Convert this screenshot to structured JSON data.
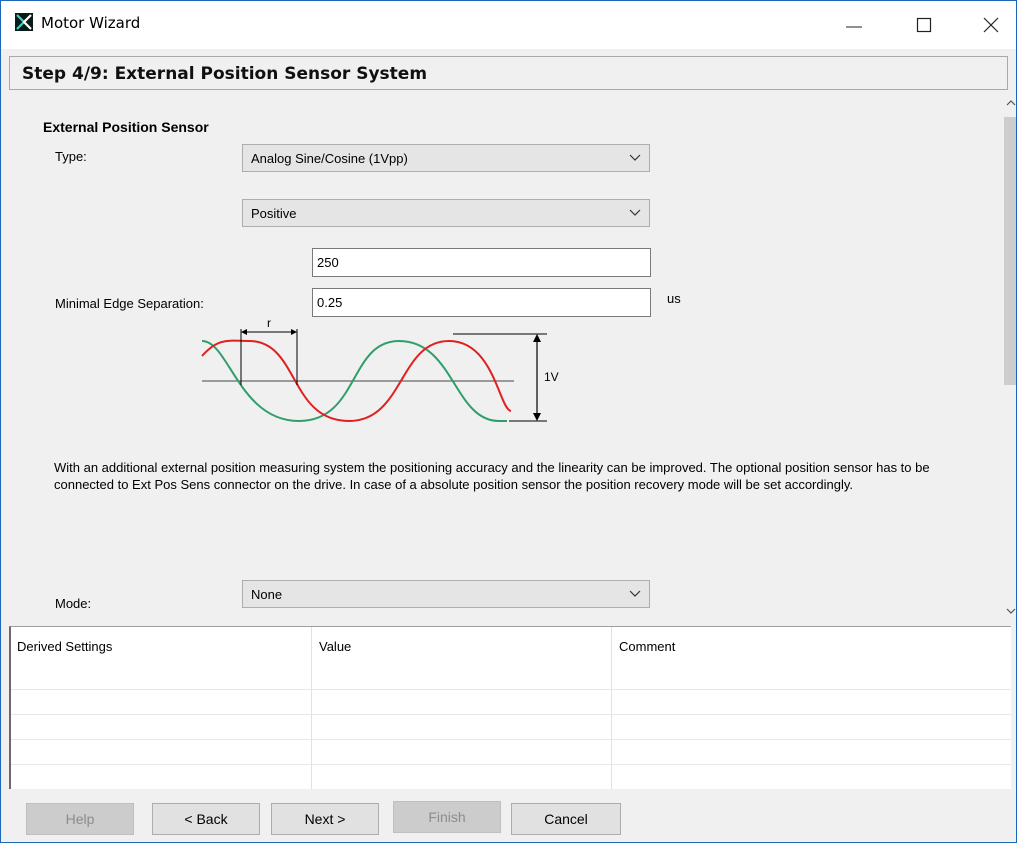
{
  "window": {
    "title": "Motor Wizard"
  },
  "header": {
    "step_title": "Step 4/9: External Position Sensor System"
  },
  "section": {
    "title": "External Position Sensor"
  },
  "type": {
    "label": "Type:",
    "selected": "Analog Sine/Cosine (1Vpp)"
  },
  "polarity": {
    "selected": "Positive"
  },
  "resolution": {
    "value": "250"
  },
  "edge_separation": {
    "label": "Minimal Edge Separation:",
    "value": "0.25",
    "unit": "us"
  },
  "diagram": {
    "r_label": "r",
    "amplitude_label": "1V"
  },
  "description": "With an additional external position measuring system the positioning accuracy and the linearity can be improved. The optional position sensor has to be connected to Ext Pos Sens connector on the drive. In case of a absolute position sensor the position recovery mode will be set accordingly.",
  "mode": {
    "label": "Mode:",
    "selected": "None"
  },
  "table": {
    "columns": [
      "Derived Settings",
      "Value",
      "Comment"
    ],
    "rows": []
  },
  "buttons": {
    "help": "Help",
    "back": "< Back",
    "next": "Next >",
    "finish": "Finish",
    "cancel": "Cancel"
  },
  "colors": {
    "red_wave": "#e02020",
    "green_wave": "#2f9e6a"
  },
  "icons": {
    "app": "motor-wizard-app-icon",
    "minimize": "minimize-icon",
    "maximize": "maximize-icon",
    "close": "close-icon"
  }
}
